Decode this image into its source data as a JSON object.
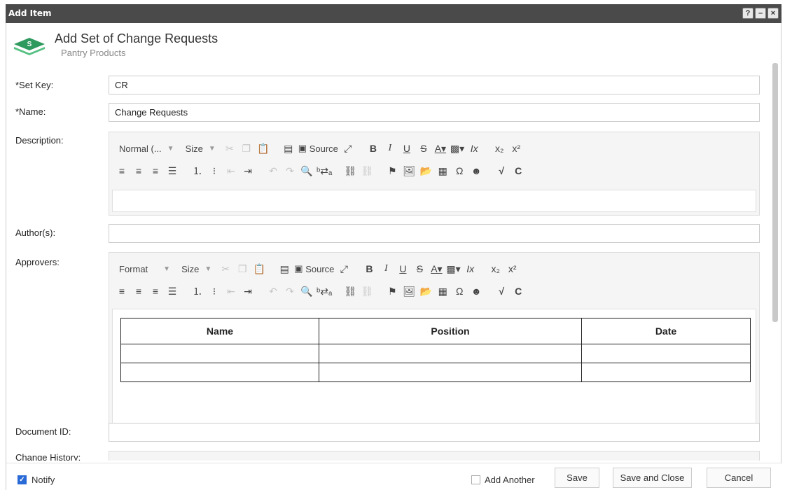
{
  "window": {
    "title": "Add Item",
    "btn_help": "?",
    "btn_min": "–",
    "btn_close": "×"
  },
  "header": {
    "title": "Add Set of Change Requests",
    "subtitle": "Pantry Products",
    "logo_letter": "S"
  },
  "form": {
    "set_key": {
      "label": "*Set Key:",
      "value": "CR"
    },
    "name": {
      "label": "*Name:",
      "value": "Change Requests"
    },
    "description": {
      "label": "Description:",
      "format_combo": "Normal (...",
      "size_combo": "Size",
      "source_label": "Source"
    },
    "authors": {
      "label": "Author(s):",
      "value": ""
    },
    "approvers": {
      "label": "Approvers:",
      "format_combo": "Format",
      "size_combo": "Size",
      "source_label": "Source",
      "table_headers": [
        "Name",
        "Position",
        "Date"
      ]
    },
    "document_id": {
      "label": "Document ID:",
      "value": ""
    },
    "change_history": {
      "label": "Change History:"
    }
  },
  "footer": {
    "notify_label": "Notify",
    "add_another_label": "Add Another",
    "save": "Save",
    "save_close": "Save and Close",
    "cancel": "Cancel"
  },
  "colors": {
    "titlebar": "#4a4a4a",
    "accent": "#2a6ad6",
    "logo_green": "#3aa86b"
  }
}
